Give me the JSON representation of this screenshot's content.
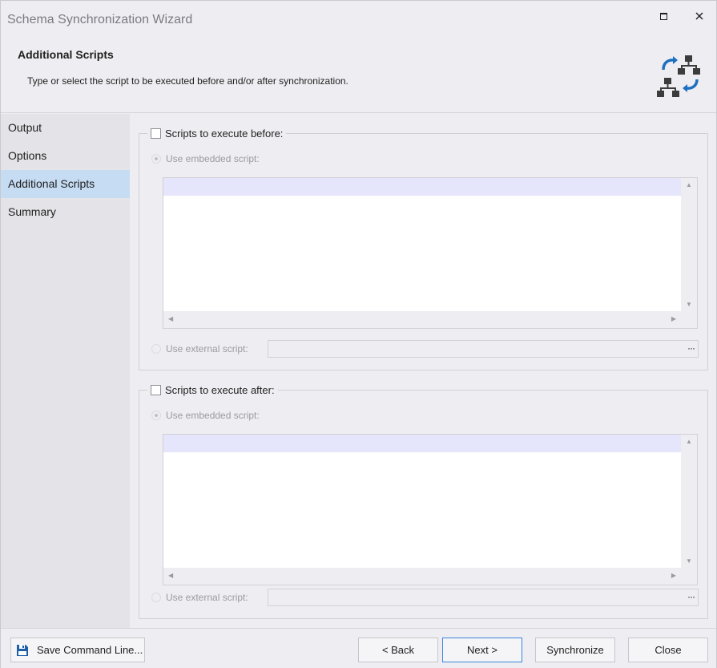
{
  "window": {
    "title": "Schema Synchronization Wizard"
  },
  "header": {
    "title": "Additional Scripts",
    "description": "Type or select the script to be executed before and/or after synchronization.",
    "icon": "schema-sync-icon"
  },
  "sidebar": {
    "items": [
      {
        "label": "Output",
        "active": false
      },
      {
        "label": "Options",
        "active": false
      },
      {
        "label": "Additional Scripts",
        "active": true
      },
      {
        "label": "Summary",
        "active": false
      }
    ]
  },
  "before": {
    "checkbox_label": "Scripts to execute before:",
    "checked": false,
    "embedded_label": "Use embedded script:",
    "embedded_selected": true,
    "external_label": "Use external script:",
    "external_value": "",
    "browse_label": "···"
  },
  "after": {
    "checkbox_label": "Scripts to execute after:",
    "checked": false,
    "embedded_label": "Use embedded script:",
    "embedded_selected": true,
    "external_label": "Use external script:",
    "external_value": "",
    "browse_label": "···"
  },
  "footer": {
    "save_label": "Save Command Line...",
    "back_label": "< Back",
    "next_label": "Next >",
    "sync_label": "Synchronize",
    "close_label": "Close"
  },
  "colors": {
    "accent": "#3a86d8",
    "sidebar_active": "#c6dcf3",
    "icon_dark": "#3c3c3c",
    "icon_blue": "#1f6fc0"
  }
}
